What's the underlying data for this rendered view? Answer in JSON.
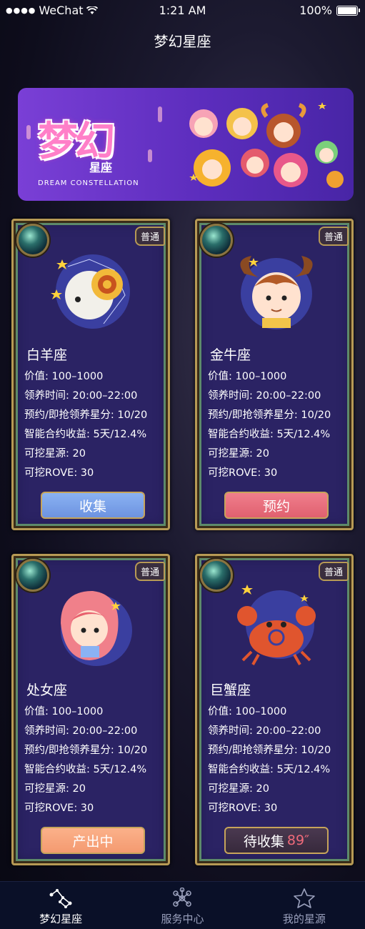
{
  "status_bar": {
    "carrier": "WeChat",
    "time": "1:21 AM",
    "battery": "100%"
  },
  "nav": {
    "title": "梦幻星座"
  },
  "banner": {
    "logo_main": "梦幻",
    "logo_sub": "星座",
    "logo_en": "DREAM CONSTELLATION"
  },
  "cards": [
    {
      "name": "白羊座",
      "rarity": "普通",
      "icon": "aries-icon",
      "stats": [
        "价值: 100–1000",
        "领养时间: 20:00–22:00",
        "预约/即抢领养星分: 10/20",
        "智能合约收益: 5天/12.4%",
        "可挖星源: 20",
        "可挖ROVE: 30"
      ],
      "action": "收集",
      "action_color": "#7a9ff0"
    },
    {
      "name": "金牛座",
      "rarity": "普通",
      "icon": "taurus-icon",
      "stats": [
        "价值: 100–1000",
        "领养时间: 20:00–22:00",
        "预约/即抢领养星分: 10/20",
        "智能合约收益: 5天/12.4%",
        "可挖星源: 20",
        "可挖ROVE: 30"
      ],
      "action": "预约",
      "action_color": "#e86a78"
    },
    {
      "name": "处女座",
      "rarity": "普通",
      "icon": "virgo-icon",
      "stats": [
        "价值: 100–1000",
        "领养时间: 20:00–22:00",
        "预约/即抢领养星分: 10/20",
        "智能合约收益: 5天/12.4%",
        "可挖星源: 20",
        "可挖ROVE: 30"
      ],
      "action": "产出中",
      "action_color": "#f6a27c"
    },
    {
      "name": "巨蟹座",
      "rarity": "普通",
      "icon": "cancer-icon",
      "stats": [
        "价值: 100–1000",
        "领养时间: 20:00–22:00",
        "预约/即抢领养星分: 10/20",
        "智能合约收益: 5天/12.4%",
        "可挖星源: 20",
        "可挖ROVE: 30"
      ],
      "action": "待收集",
      "action_countdown": "89″",
      "action_color": "#3f2f45"
    }
  ],
  "tabs": [
    {
      "label": "梦幻星座",
      "icon": "constellation-icon",
      "active": true
    },
    {
      "label": "服务中心",
      "icon": "network-icon",
      "active": false
    },
    {
      "label": "我的星源",
      "icon": "star-icon",
      "active": false
    }
  ]
}
